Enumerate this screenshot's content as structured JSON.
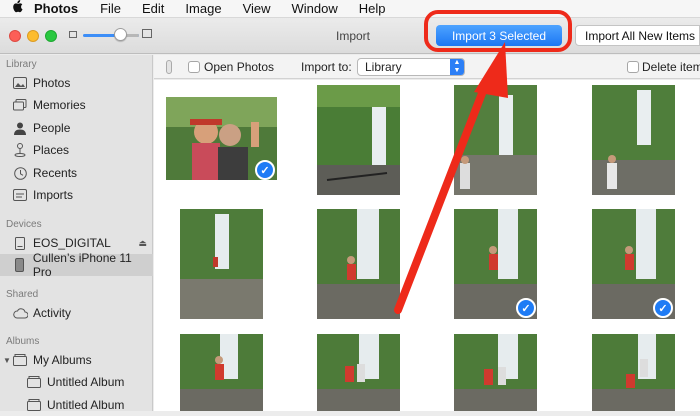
{
  "menubar": {
    "apple": "",
    "items": [
      "Photos",
      "File",
      "Edit",
      "Image",
      "View",
      "Window",
      "Help"
    ]
  },
  "toolbar": {
    "title": "Import",
    "import_selected_label": "Import 3 Selected",
    "import_all_label": "Import All New Items"
  },
  "sidebar": {
    "library_header": "Library",
    "library_items": [
      "Photos",
      "Memories",
      "People",
      "Places",
      "Recents",
      "Imports"
    ],
    "devices_header": "Devices",
    "devices": [
      "EOS_DIGITAL",
      "Cullen’s iPhone 11 Pro"
    ],
    "shared_header": "Shared",
    "shared_items": [
      "Activity"
    ],
    "albums_header": "Albums",
    "my_albums": "My Albums",
    "albums": [
      "Untitled Album",
      "Untitled Album"
    ]
  },
  "options": {
    "open_photos_label": "Open Photos",
    "import_to_label": "Import to:",
    "import_to_value": "Library",
    "delete_items_label": "Delete items"
  },
  "grid": {
    "selected_count": 3
  },
  "colors": {
    "accent": "#1f7cf5",
    "highlight": "#ee2a1a"
  }
}
